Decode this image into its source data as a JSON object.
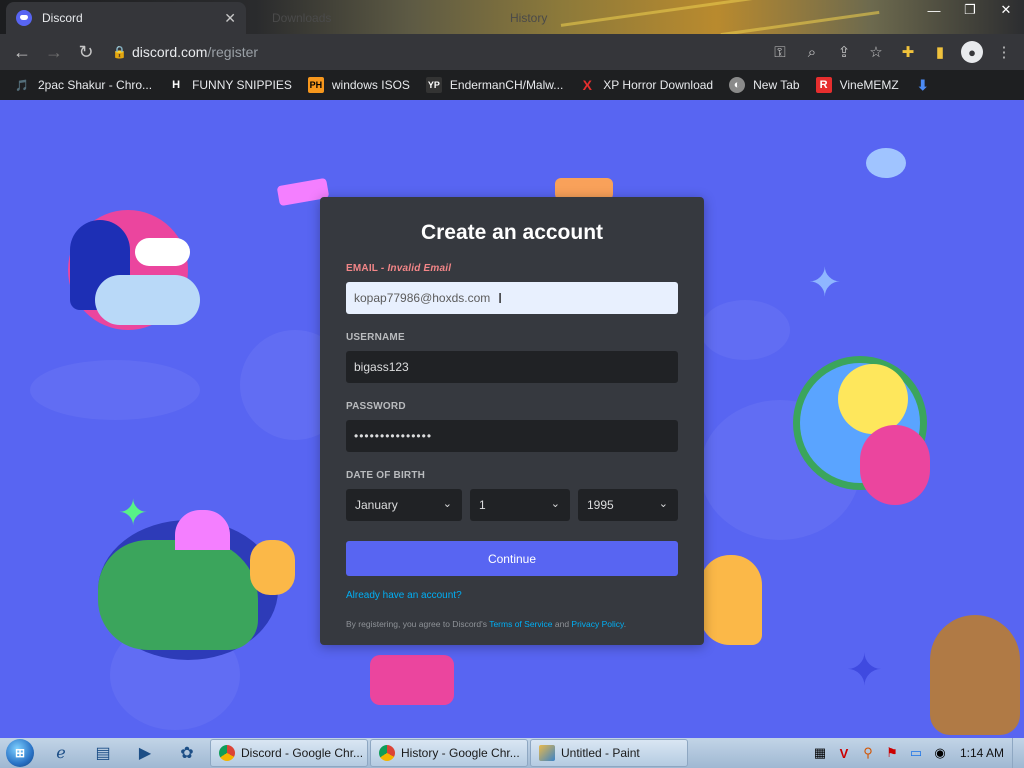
{
  "browser": {
    "active_tab": {
      "title": "Discord",
      "close": "✕"
    },
    "inactive_tabs": [
      {
        "title": "Downloads"
      },
      {
        "title": "History"
      }
    ],
    "window_controls": [
      "—",
      "❐",
      "✕"
    ],
    "nav": {
      "back": "←",
      "forward": "→",
      "reload": "↻"
    },
    "url": {
      "host": "discord.com",
      "path": "/register"
    },
    "toolbar_icons": [
      "key-icon",
      "zoom-icon",
      "share-icon",
      "star-icon",
      "extensions-icon",
      "sidebar-icon",
      "profile-icon",
      "menu-icon"
    ],
    "bookmarks": [
      {
        "label": "2pac Shakur - Chro...",
        "icon": "🎵",
        "color": "#ffffff"
      },
      {
        "label": "FUNNY SNIPPIES",
        "icon": "H",
        "color": "#ffffff"
      },
      {
        "label": "windows ISOS",
        "icon": "PH",
        "color": "#f7971d"
      },
      {
        "label": "EndermanCH/Malw...",
        "icon": "YP",
        "color": "#ffffff"
      },
      {
        "label": "XP Horror Download",
        "icon": "X",
        "color": "#e62e2e"
      },
      {
        "label": "New Tab",
        "icon": "◐",
        "color": "#c8c8c8"
      },
      {
        "label": "VineMEMZ",
        "icon": "R",
        "color": "#e62e2e"
      },
      {
        "label": "",
        "icon": "⬇",
        "color": "#4c8bf5"
      }
    ]
  },
  "form": {
    "title": "Create an account",
    "email": {
      "label": "EMAIL",
      "error": "Invalid Email",
      "value": "kopap77986@hoxds.com"
    },
    "username": {
      "label": "USERNAME",
      "value": "bigass123"
    },
    "password": {
      "label": "PASSWORD",
      "value": "•••••••••••••••"
    },
    "dob": {
      "label": "DATE OF BIRTH",
      "month": "January",
      "day": "1",
      "year": "1995"
    },
    "continue": "Continue",
    "login_link": "Already have an account?",
    "legal": {
      "prefix": "By registering, you agree to Discord's ",
      "tos": "Terms of Service",
      "and": " and ",
      "privacy": "Privacy Policy",
      "suffix": "."
    }
  },
  "taskbar": {
    "start_label": "⊞",
    "quick_launch": [
      "ie-icon",
      "explorer-icon",
      "media-icon",
      "app-icon"
    ],
    "buttons": [
      {
        "label": "Discord - Google Chr...",
        "icon": "chrome"
      },
      {
        "label": "History - Google Chr...",
        "icon": "chrome"
      },
      {
        "label": "Untitled - Paint",
        "icon": "paint"
      }
    ],
    "clock": "1:14 AM"
  },
  "colors": {
    "blurple": "#5865f2",
    "card": "#36393f",
    "input": "#202225",
    "error": "#f38688",
    "link": "#00aff4"
  }
}
